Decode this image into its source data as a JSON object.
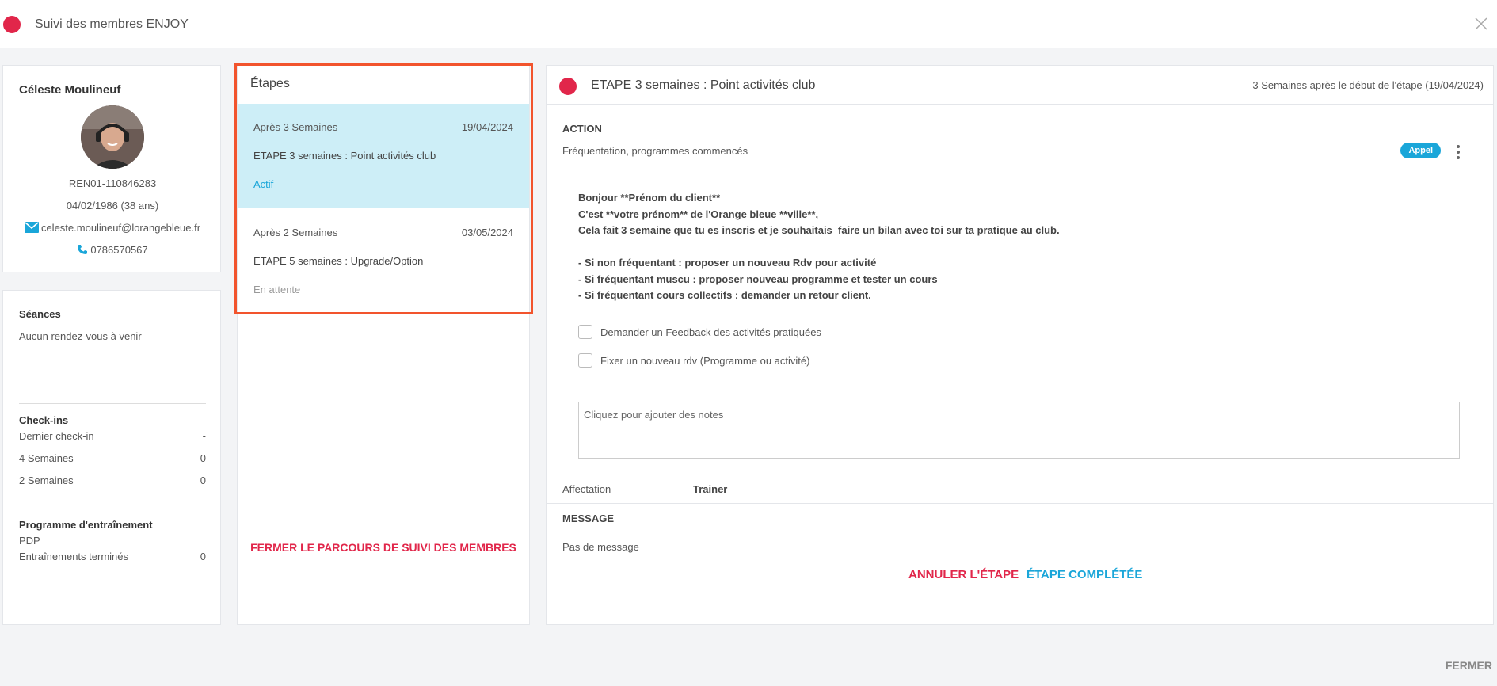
{
  "header": {
    "title": "Suivi des membres ENJOY",
    "status_color": "#e1264a"
  },
  "member": {
    "name": "Céleste Moulineuf",
    "id": "REN01-110846283",
    "birth": "04/02/1986 (38 ans)",
    "email": "celeste.moulineuf@lorangebleue.fr",
    "phone": "0786570567"
  },
  "seances": {
    "title": "Séances",
    "empty": "Aucun rendez-vous à venir",
    "checkins_title": "Check-ins",
    "checkins": [
      {
        "label": "Dernier check-in",
        "value": "-"
      },
      {
        "label": "4 Semaines",
        "value": "0"
      },
      {
        "label": "2 Semaines",
        "value": "0"
      }
    ],
    "programme_title": "Programme d'entraînement",
    "programme_name": "PDP",
    "trainings_label": "Entraînements terminés",
    "trainings_value": "0"
  },
  "etapes": {
    "title": "Étapes",
    "steps": [
      {
        "when": "Après 3 Semaines",
        "date": "19/04/2024",
        "title": "ETAPE 3 semaines : Point activités club",
        "status": "Actif"
      },
      {
        "when": "Après 2 Semaines",
        "date": "03/05/2024",
        "title": "ETAPE 5 semaines : Upgrade/Option",
        "status": "En attente"
      }
    ],
    "close_label": "FERMER LE PARCOURS DE SUIVI DES MEMBRES"
  },
  "detail": {
    "title": "ETAPE 3 semaines : Point activités club",
    "timing": "3 Semaines après le début de l'étape (19/04/2024)",
    "action_label": "ACTION",
    "action_desc": "Fréquentation, programmes commencés",
    "badge": "Appel",
    "message_lines": [
      "Bonjour **Prénom du client**",
      "C'est **votre prénom** de l'Orange bleue **ville**,",
      "Cela fait 3 semaine que tu es inscris et je souhaitais  faire un bilan avec toi sur ta pratique au club.",
      "",
      "- Si non fréquentant : proposer un nouveau Rdv pour activité",
      "- Si fréquentant muscu : proposer nouveau programme et tester un cours",
      "- Si fréquentant cours collectifs : demander un retour client."
    ],
    "tasks": [
      "Demander un Feedback des activités pratiquées",
      "Fixer un nouveau rdv (Programme ou activité)"
    ],
    "notes_placeholder": "Cliquez pour ajouter des notes",
    "affectation_label": "Affectation",
    "affectation_value": "Trainer",
    "message_label": "MESSAGE",
    "no_message": "Pas de message",
    "cancel_label": "ANNULER L'ÉTAPE",
    "complete_label": "ÉTAPE COMPLÉTÉE"
  },
  "footer": {
    "close_label": "FERMER"
  },
  "colors": {
    "accent": "#1aa6d9",
    "danger": "#e1264a",
    "active_bg": "#cdeef7",
    "highlight": "#f2542d"
  }
}
